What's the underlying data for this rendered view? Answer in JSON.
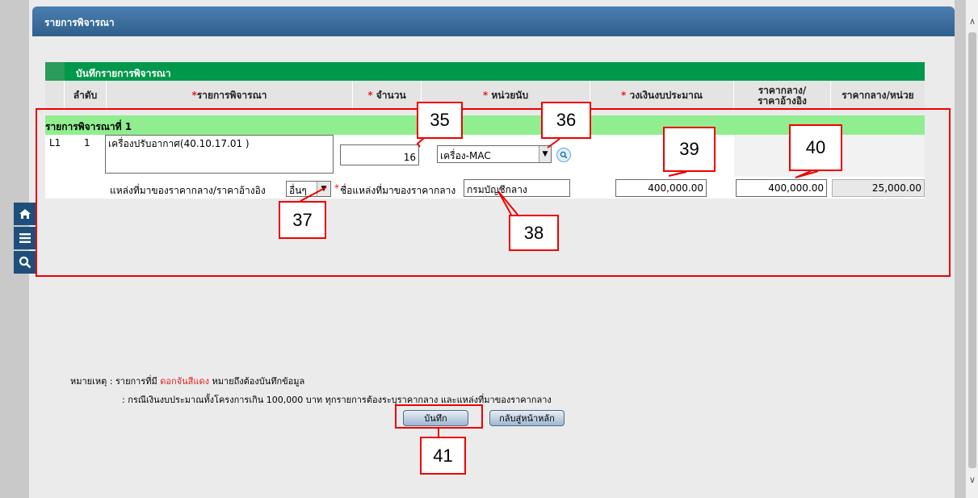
{
  "header": {
    "title": "รายการพิจารณา"
  },
  "section": {
    "title": "บันทึกรายการพิจารณา"
  },
  "table": {
    "columns": {
      "order": "ลำดับ",
      "item": "รายการพิจารณา",
      "qty": "จำนวน",
      "unit": "หน่วยนับ",
      "budget": "วงเงินงบประมาณ",
      "ref_price_1": "ราคากลาง/",
      "ref_price_2": "ราคาอ้างอิง",
      "unit_price": "ราคากลาง/หน่วย"
    },
    "required_mark": "*"
  },
  "group": {
    "label": "รายการพิจารณาที่ 1"
  },
  "row": {
    "level": "L1",
    "order": "1",
    "item_text": "เครื่องปรับอากาศ(40.10.17.01 )",
    "qty": "16",
    "unit": "เครื่อง-MAC",
    "source_label": "แหล่งที่มาของราคากลาง/ราคาอ้างอิง",
    "source_value": "อื่นๆ",
    "source_name_label": "ชื่อแหล่งที่มาของราคากลาง",
    "source_name_value": "กรมบัญชีกลาง",
    "budget": "400,000.00",
    "ref_price": "400,000.00",
    "unit_price": "25,000.00"
  },
  "notes": {
    "line1_prefix": "หมายเหตุ : รายการที่มี ",
    "line1_red": "ดอกจันสีแดง",
    "line1_suffix": " หมายถึงต้องบันทึกข้อมูล",
    "line2": ": กรณีเงินงบประมาณทั้งโครงการเกิน 100,000 บาท ทุกรายการต้องระบุราคากลาง และแหล่งที่มาของราคากลาง"
  },
  "buttons": {
    "save": "บันทึก",
    "back": "กลับสู่หน้าหลัก"
  },
  "callouts": {
    "c35": "35",
    "c36": "36",
    "c37": "37",
    "c38": "38",
    "c39": "39",
    "c40": "40",
    "c41": "41"
  },
  "icons": {
    "home": "home-icon",
    "menu": "menu-icon",
    "search": "search-icon",
    "lookup": "magnifier-icon"
  },
  "colors": {
    "header": "#2f5f8c",
    "section": "#00984a",
    "group": "#90ee90",
    "annotation": "#e00000"
  }
}
